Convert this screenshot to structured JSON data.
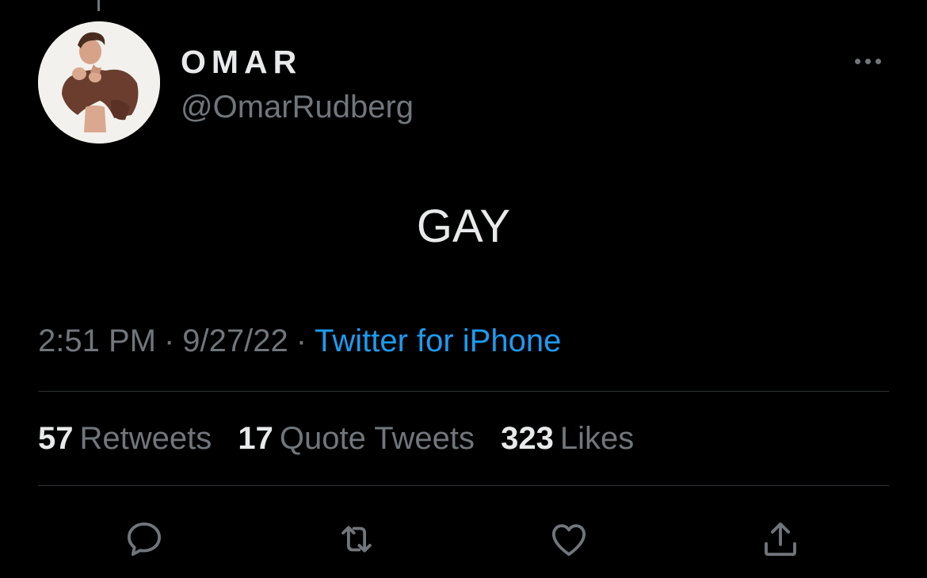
{
  "tweet": {
    "display_name": "OMAR",
    "handle": "@OmarRudberg",
    "text": "GAY",
    "time": "2:51 PM",
    "separator": "·",
    "date": "9/27/22",
    "source": "Twitter for iPhone"
  },
  "stats": {
    "retweets": {
      "count": "57",
      "label": "Retweets"
    },
    "quotes": {
      "count": "17",
      "label": "Quote Tweets"
    },
    "likes": {
      "count": "323",
      "label": "Likes"
    }
  },
  "icons": {
    "more": "more-icon",
    "reply": "reply-icon",
    "retweet": "retweet-icon",
    "like": "heart-icon",
    "share": "share-icon"
  },
  "colors": {
    "background": "#000000",
    "primary_text": "#e7e9ea",
    "secondary_text": "#71767b",
    "accent": "#1d9bf0",
    "divider": "#2f3336"
  }
}
